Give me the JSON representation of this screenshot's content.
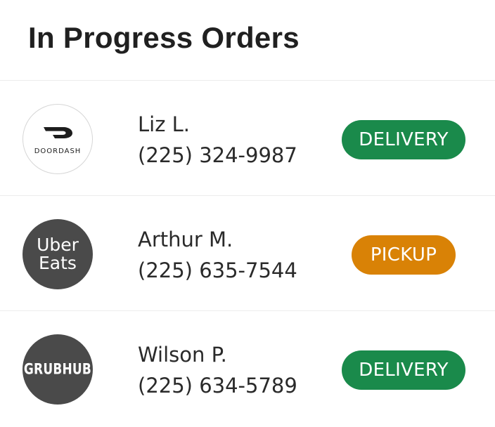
{
  "header": {
    "title": "In Progress Orders"
  },
  "orders": [
    {
      "service": "DoorDash",
      "logo_text": "DOORDASH",
      "customer_name": "Liz L.",
      "phone": "(225) 324-9987",
      "type": "DELIVERY"
    },
    {
      "service": "Uber Eats",
      "logo_line1": "Uber",
      "logo_line2": "Eats",
      "customer_name": "Arthur M.",
      "phone": "(225) 635-7544",
      "type": "PICKUP"
    },
    {
      "service": "Grubhub",
      "logo_text": "GRUBHUB",
      "customer_name": "Wilson P.",
      "phone": "(225) 634-5789",
      "type": "DELIVERY"
    }
  ],
  "colors": {
    "delivery": "#1a8a4b",
    "pickup": "#d98206",
    "logo_dark": "#4a4a4a"
  }
}
